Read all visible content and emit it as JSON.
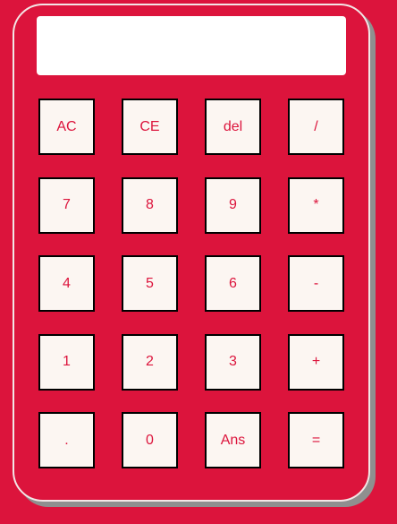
{
  "display": {
    "value": ""
  },
  "keys": [
    {
      "id": "ac",
      "label": "AC"
    },
    {
      "id": "ce",
      "label": "CE"
    },
    {
      "id": "del",
      "label": "del"
    },
    {
      "id": "divide",
      "label": "/"
    },
    {
      "id": "7",
      "label": "7"
    },
    {
      "id": "8",
      "label": "8"
    },
    {
      "id": "9",
      "label": "9"
    },
    {
      "id": "multiply",
      "label": "*"
    },
    {
      "id": "4",
      "label": "4"
    },
    {
      "id": "5",
      "label": "5"
    },
    {
      "id": "6",
      "label": "6"
    },
    {
      "id": "subtract",
      "label": "-"
    },
    {
      "id": "1",
      "label": "1"
    },
    {
      "id": "2",
      "label": "2"
    },
    {
      "id": "3",
      "label": "3"
    },
    {
      "id": "add",
      "label": "+"
    },
    {
      "id": "decimal",
      "label": "."
    },
    {
      "id": "0",
      "label": "0"
    },
    {
      "id": "ans",
      "label": "Ans"
    },
    {
      "id": "equals",
      "label": "="
    }
  ],
  "colors": {
    "page_background": "#dc143c",
    "key_text": "#dc143c",
    "key_background": "#fcf6f2",
    "key_border": "#000000",
    "display_background": "#ffffff"
  }
}
